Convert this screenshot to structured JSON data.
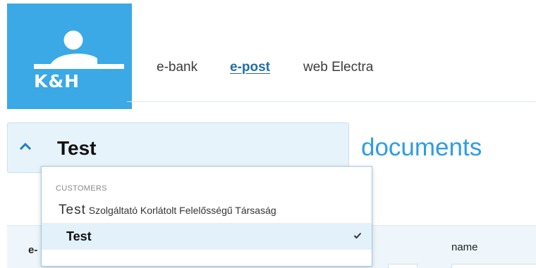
{
  "brand": {
    "logo_text": "K&H",
    "color": "#3aa9e6"
  },
  "nav": {
    "items": [
      {
        "label": "e-bank"
      },
      {
        "label": "e-post",
        "active": true
      },
      {
        "label": "web Electra"
      }
    ]
  },
  "customer_selector": {
    "current": "Test",
    "expanded": true,
    "icon": "chevron-up-icon"
  },
  "page_heading": "documents",
  "dropdown": {
    "section_label": "CUSTOMERS",
    "items": [
      {
        "label_prefix": "Test",
        "label_rest": " Szolgáltató Korlátolt Felelősségű Társaság",
        "selected": false
      },
      {
        "label": "Test",
        "selected": true,
        "icon": "checkmark-icon"
      }
    ]
  },
  "table": {
    "columns": [
      {
        "label": "e-"
      },
      {
        "label": "name"
      }
    ]
  },
  "colors": {
    "accent": "#2f9de0",
    "selector_bg": "#e7f3fa",
    "selected_row": "#e3f1fa"
  }
}
